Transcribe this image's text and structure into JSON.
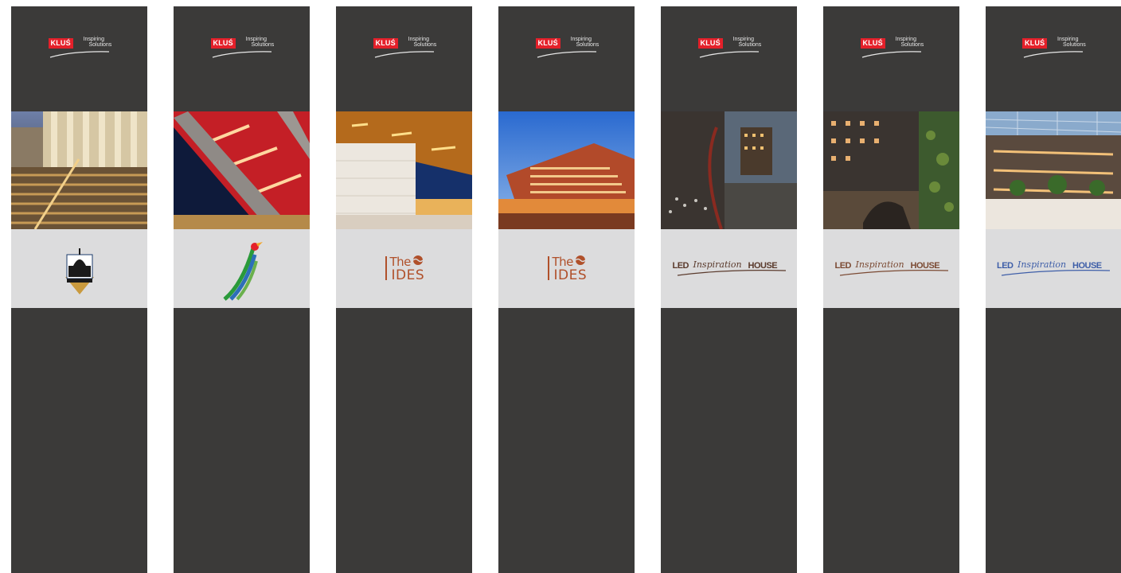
{
  "brand": {
    "name": "KLUŚ",
    "tagline_line1": "Inspiring",
    "tagline_line2": "Solutions",
    "color": "#e4202a"
  },
  "banners": [
    {
      "logo_type": "capitol-seal",
      "logo_text": ""
    },
    {
      "logo_type": "bird-mark",
      "logo_text": ""
    },
    {
      "logo_type": "tides",
      "logo_the": "The",
      "logo_ides": "IDES"
    },
    {
      "logo_type": "tides",
      "logo_the": "The",
      "logo_ides": "IDES"
    },
    {
      "logo_type": "led-house",
      "led": "LED",
      "inspiration": "Inspiration",
      "house": "HOUSE",
      "color": "#5a3a2c"
    },
    {
      "logo_type": "led-house",
      "led": "LED",
      "inspiration": "Inspiration",
      "house": "HOUSE",
      "color": "#7b4a33"
    },
    {
      "logo_type": "led-house",
      "led": "LED",
      "inspiration": "Inspiration",
      "house": "HOUSE",
      "color": "#3e5ea8"
    }
  ],
  "colors": {
    "panel": "#3b3a39",
    "logo_band": "#dcdcdd"
  }
}
